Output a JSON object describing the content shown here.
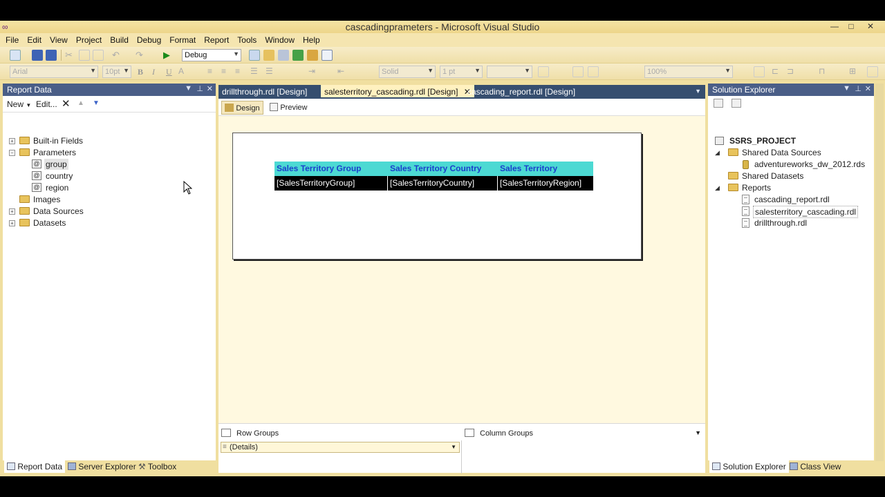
{
  "window": {
    "title": "cascadingprameters - Microsoft Visual Studio",
    "buttons": {
      "minimize": "—",
      "maximize": "□",
      "close": "✕"
    }
  },
  "menu": [
    "File",
    "Edit",
    "View",
    "Project",
    "Build",
    "Debug",
    "Format",
    "Report",
    "Tools",
    "Window",
    "Help"
  ],
  "toolbar": {
    "config": "Debug",
    "font": "Arial",
    "font_size": "10pt",
    "bold": "B",
    "italic": "I",
    "underline": "U",
    "border_style": "Solid",
    "border_width": "1 pt",
    "zoom": "100%"
  },
  "report_data": {
    "title": "Report Data",
    "new_label": "New",
    "edit_label": "Edit...",
    "tree": {
      "builtin": "Built-in Fields",
      "parameters": "Parameters",
      "params": [
        "group",
        "country",
        "region"
      ],
      "images": "Images",
      "data_sources": "Data Sources",
      "datasets": "Datasets"
    }
  },
  "doc_tabs": [
    "drillthrough.rdl [Design]",
    "salesterritory_cascading.rdl [Design]",
    "cascading_report.rdl [Design]"
  ],
  "designer": {
    "design_tab": "Design",
    "preview_tab": "Preview",
    "table": {
      "headers": [
        "Sales Territory Group",
        "Sales Territory Country",
        "Sales Territory"
      ],
      "cells": [
        "[SalesTerritoryGroup]",
        "[SalesTerritoryCountry]",
        "[SalesTerritoryRegion]"
      ]
    },
    "row_groups": "Row Groups",
    "column_groups": "Column Groups",
    "details": "(Details)"
  },
  "solution_explorer": {
    "title": "Solution Explorer",
    "project": "SSRS_PROJECT",
    "shared_data_sources": "Shared Data Sources",
    "data_source_file": "adventureworks_dw_2012.rds",
    "shared_datasets": "Shared Datasets",
    "reports": "Reports",
    "report_files": [
      "cascading_report.rdl",
      "salesterritory_cascading.rdl",
      "drillthrough.rdl"
    ]
  },
  "bottom_tabs_left": [
    "Report Data",
    "Server Explorer",
    "Toolbox"
  ],
  "bottom_tabs_right": [
    "Solution Explorer",
    "Class View"
  ],
  "colors": {
    "header_fill": "#4cd9d3",
    "header_text": "#1a3fcc",
    "panel_title": "#4a5e87",
    "chrome": "#f0dfa0"
  }
}
